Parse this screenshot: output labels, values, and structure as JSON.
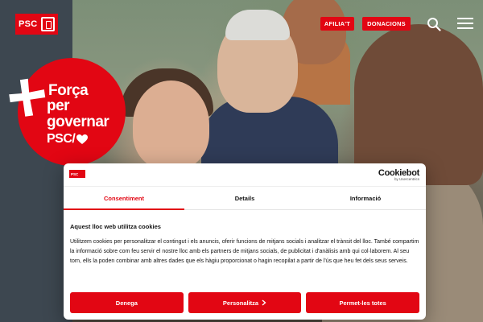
{
  "header": {
    "logo_text": "PSC",
    "afilia_label": "AFILIA'T",
    "donacions_label": "DONACIONS",
    "search_icon": "search-icon",
    "menu_icon": "hamburger-menu-icon"
  },
  "badge": {
    "line1": "Força",
    "line2": "per",
    "line3": "governar",
    "line4": "PSC/"
  },
  "cookie": {
    "provider_brand": "Cookiebot",
    "provider_by": "by Usercentrics",
    "tabs": [
      {
        "label": "Consentiment",
        "active": true
      },
      {
        "label": "Details",
        "active": false
      },
      {
        "label": "Informació",
        "active": false
      }
    ],
    "heading": "Aquest lloc web utilitza cookies",
    "body": "Utilitzem cookies per personalitzar el contingut i els anuncis, oferir funcions de mitjans socials i analitzar el trànsit del lloc. També compartim la informació sobre com feu servir el nostre lloc amb els partners de mitjans socials, de publicitat i d'anàlisis amb qui col·laborem. Al seu torn, ells la poden combinar amb altres dades que els hàgiu proporcionat o hagin recopilat a partir de l'ús que heu fet dels seus serveis.",
    "buttons": {
      "deny": "Denega",
      "customize": "Personalitza",
      "allow_all": "Permet-les totes"
    }
  },
  "colors": {
    "brand_red": "#e20613"
  }
}
